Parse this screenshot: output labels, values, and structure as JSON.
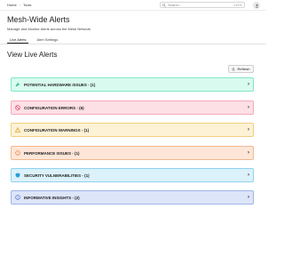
{
  "breadcrumb": {
    "home": "Home",
    "separator": "›",
    "current": "Tools"
  },
  "search": {
    "placeholder": "Search...",
    "shortcut": "Ctrl+K"
  },
  "header": {
    "title": "Mesh-Wide Alerts",
    "subtitle": "Manage and Monitor Alerts across the Mesh Network"
  },
  "tabs": [
    {
      "label": "Live Alerts",
      "active": true
    },
    {
      "label": "Alert Settings",
      "active": false
    }
  ],
  "section": {
    "title": "View Live Alerts"
  },
  "refresh": {
    "label": "Refresh"
  },
  "alerts": [
    {
      "label": "POTENTIAL HARDWARE ISSUES - (1)",
      "icon": "wrench-icon",
      "bg": "#d9fbef",
      "border": "#7ee8c3",
      "iconColor": "#19a97a"
    },
    {
      "label": "CONFIGURATION ERRORS - (6)",
      "icon": "ban-icon",
      "bg": "#fde0e6",
      "border": "#f5a9b8",
      "iconColor": "#e0455f"
    },
    {
      "label": "CONFIGURATION WARNINGS - (1)",
      "icon": "warning-icon",
      "bg": "#fdf2d6",
      "border": "#f1cf7c",
      "iconColor": "#d79b14"
    },
    {
      "label": "PERFORMANCE ISSUES - (1)",
      "icon": "error-icon",
      "bg": "#fde6d8",
      "border": "#f3b88f",
      "iconColor": "#e07a36"
    },
    {
      "label": "SECURITY VULNERABILITIES - (1)",
      "icon": "shield-icon",
      "bg": "#dcf2fb",
      "border": "#8fd2ef",
      "iconColor": "#2a9fd6"
    },
    {
      "label": "INFORMATIVE INSIGHTS - (2)",
      "icon": "info-icon",
      "bg": "#dde5f8",
      "border": "#9db3e8",
      "iconColor": "#3e63c9"
    }
  ]
}
